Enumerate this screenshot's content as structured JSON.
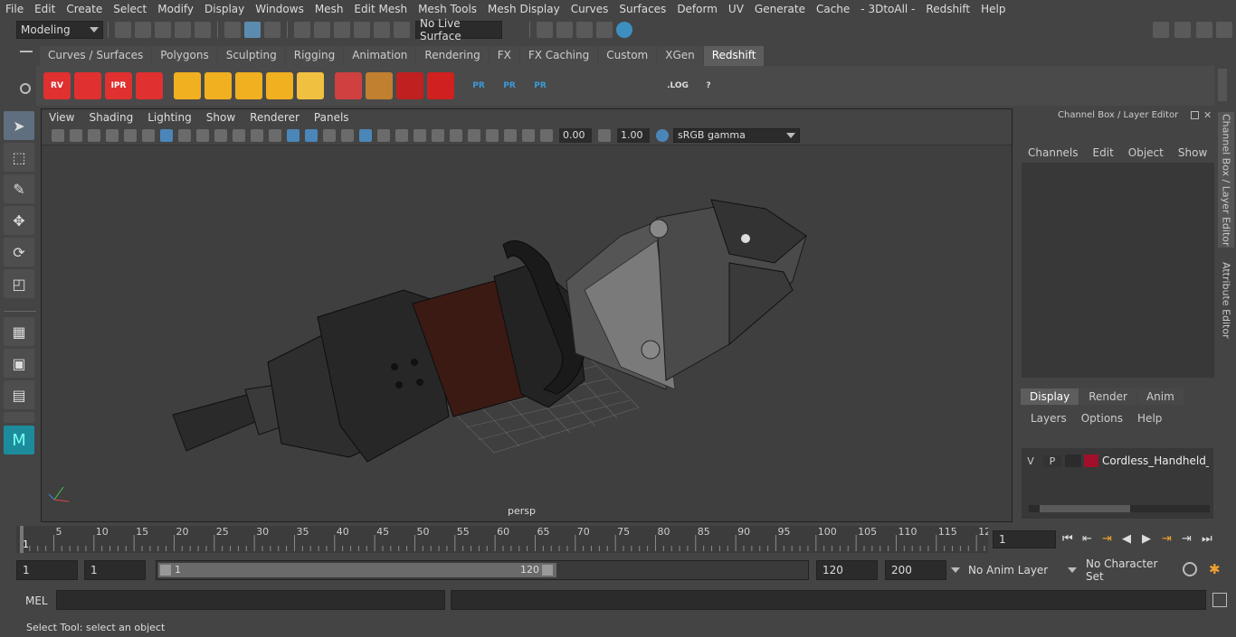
{
  "menubar": [
    "File",
    "Edit",
    "Create",
    "Select",
    "Modify",
    "Display",
    "Windows",
    "Mesh",
    "Edit Mesh",
    "Mesh Tools",
    "Mesh Display",
    "Curves",
    "Surfaces",
    "Deform",
    "UV",
    "Generate",
    "Cache",
    "- 3DtoAll -",
    "Redshift",
    "Help"
  ],
  "status": {
    "mode": "Modeling",
    "live_surface": "No Live Surface"
  },
  "shelf_tabs": [
    "Curves / Surfaces",
    "Polygons",
    "Sculpting",
    "Rigging",
    "Animation",
    "Rendering",
    "FX",
    "FX Caching",
    "Custom",
    "XGen",
    "Redshift"
  ],
  "shelf_active": "Redshift",
  "shelf_icons": [
    {
      "name": "rv-icon",
      "label": "RV",
      "color": "#e03030"
    },
    {
      "name": "render-sequence-icon",
      "label": "",
      "color": "#e03030"
    },
    {
      "name": "ipr-icon",
      "label": "IPR",
      "color": "#e03030"
    },
    {
      "name": "render-settings-icon",
      "label": "",
      "color": "#e03030"
    },
    {
      "name": "light-icon",
      "label": "",
      "color": "#f0b020"
    },
    {
      "name": "area-light-icon",
      "label": "",
      "color": "#f0b020"
    },
    {
      "name": "spot-light-icon",
      "label": "",
      "color": "#f0b020"
    },
    {
      "name": "dome-light-icon",
      "label": "",
      "color": "#f0b020"
    },
    {
      "name": "sun-light-icon",
      "label": "",
      "color": "#f0c040"
    },
    {
      "name": "proxy-icon",
      "label": "",
      "color": "#d04040"
    },
    {
      "name": "hair-icon",
      "label": "",
      "color": "#c08030"
    },
    {
      "name": "volume-icon",
      "label": "",
      "color": "#c02020"
    },
    {
      "name": "sphere-icon",
      "label": "",
      "color": "#d02020"
    },
    {
      "name": "pr-cube-icon",
      "label": "PR",
      "color": "#3a9ad8"
    },
    {
      "name": "pr-export-icon",
      "label": "PR",
      "color": "#3a9ad8"
    },
    {
      "name": "pr-swap-icon",
      "label": "PR",
      "color": "#3a9ad8"
    },
    {
      "name": "bake-icon",
      "label": "",
      "color": "#dddddd"
    },
    {
      "name": "bake-set-icon",
      "label": "",
      "color": "#dddddd"
    },
    {
      "name": "code-icon",
      "label": "",
      "color": "#dddddd"
    },
    {
      "name": "log-icon",
      "label": ".LOG",
      "color": "#dddddd"
    },
    {
      "name": "help-icon",
      "label": "?",
      "color": "#dddddd"
    }
  ],
  "viewport": {
    "menu": [
      "View",
      "Shading",
      "Lighting",
      "Show",
      "Renderer",
      "Panels"
    ],
    "near_value": "0.00",
    "far_value": "1.00",
    "color_space": "sRGB gamma",
    "camera_label": "persp"
  },
  "channel_box": {
    "title": "Channel Box / Layer Editor",
    "menu": [
      "Channels",
      "Edit",
      "Object",
      "Show"
    ],
    "layer_tabs": [
      "Display",
      "Render",
      "Anim"
    ],
    "layer_tab_active": "Display",
    "layer_menu": [
      "Layers",
      "Options",
      "Help"
    ],
    "layer_row": {
      "v": "V",
      "p": "P",
      "color": "#a0102a",
      "name": "Cordless_Handheld_Sp"
    }
  },
  "side_tabs": [
    "Channel Box / Layer Editor",
    "Attribute Editor"
  ],
  "timeline": {
    "ticks": [
      "5",
      "10",
      "15",
      "20",
      "25",
      "30",
      "35",
      "40",
      "45",
      "50",
      "55",
      "60",
      "65",
      "70",
      "75",
      "80",
      "85",
      "90",
      "95",
      "100",
      "105",
      "110",
      "115",
      "12"
    ],
    "start_marker": "1",
    "current_frame": "1"
  },
  "range": {
    "start": "1",
    "start2": "1",
    "slider_start": "1",
    "slider_end": "120",
    "end": "120",
    "end2": "200",
    "anim_layer": "No Anim Layer",
    "character_set": "No Character Set"
  },
  "cmd": {
    "lang": "MEL"
  },
  "help_line": "Select Tool: select an object"
}
